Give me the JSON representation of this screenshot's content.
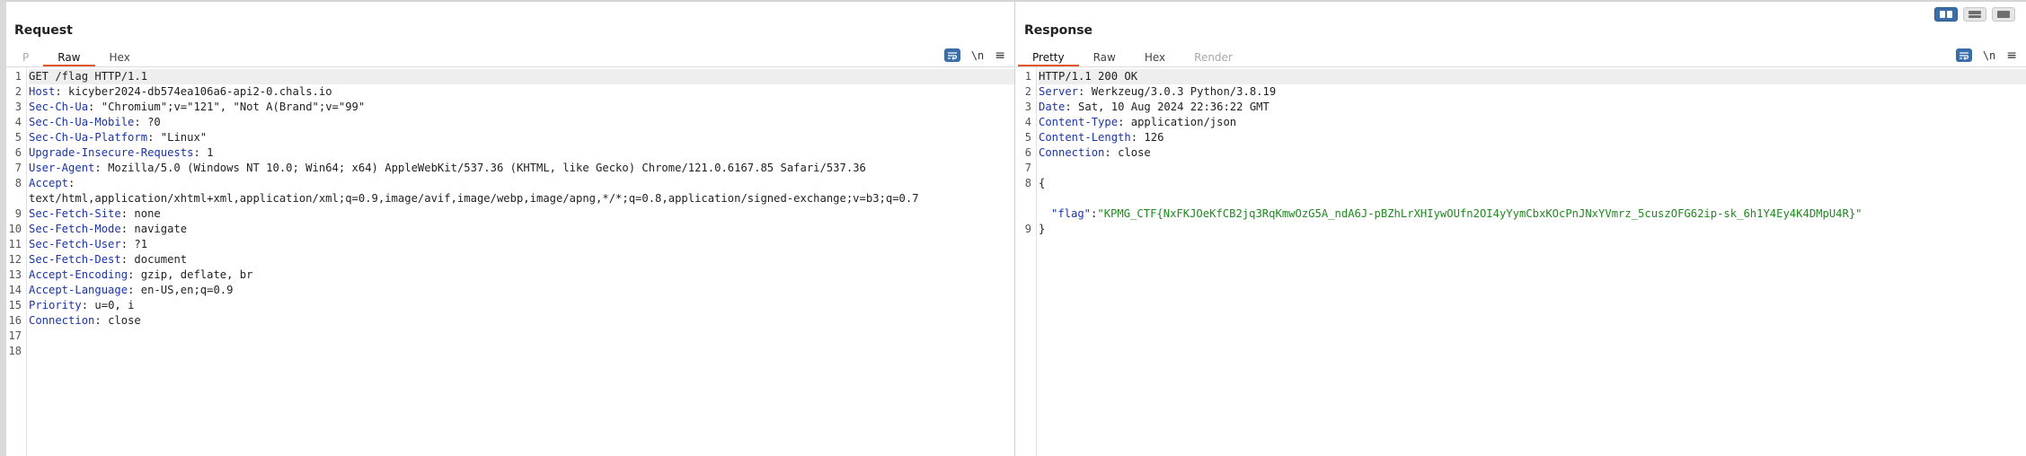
{
  "layout_buttons": [
    {
      "name": "side-by-side",
      "active": true
    },
    {
      "name": "top-bottom",
      "active": false
    },
    {
      "name": "tabs-only",
      "active": false
    }
  ],
  "request": {
    "title": "Request",
    "tabs": [
      "P",
      "Raw",
      "Hex"
    ],
    "tools": {
      "newline": "\\n",
      "menu": "≡"
    },
    "first_line": "GET /flag HTTP/1.1",
    "headers": [
      {
        "name": "Host",
        "sep": ": ",
        "value": "kicyber2024-db574ea106a6-api2-0.chals.io"
      },
      {
        "name": "Sec-Ch-Ua",
        "sep": ": ",
        "value": "\"Chromium\";v=\"121\", \"Not A(Brand\";v=\"99\""
      },
      {
        "name": "Sec-Ch-Ua-Mobile",
        "sep": ": ",
        "value": "?0"
      },
      {
        "name": "Sec-Ch-Ua-Platform",
        "sep": ": ",
        "value": "\"Linux\""
      },
      {
        "name": "Upgrade-Insecure-Requests",
        "sep": ": ",
        "value": "1"
      },
      {
        "name": "User-Agent",
        "sep": ": ",
        "value": "Mozilla/5.0 (Windows NT 10.0; Win64; x64) AppleWebKit/537.36 (KHTML, like Gecko) Chrome/121.0.6167.85 Safari/537.36"
      },
      {
        "name": "Accept",
        "sep": ":",
        "value": "text/html,application/xhtml+xml,application/xml;q=0.9,image/avif,image/webp,image/apng,*/*;q=0.8,application/signed-exchange;v=b3;q=0.7"
      },
      {
        "name": "Sec-Fetch-Site",
        "sep": ": ",
        "value": "none"
      },
      {
        "name": "Sec-Fetch-Mode",
        "sep": ": ",
        "value": "navigate"
      },
      {
        "name": "Sec-Fetch-User",
        "sep": ": ",
        "value": "?1"
      },
      {
        "name": "Sec-Fetch-Dest",
        "sep": ": ",
        "value": "document"
      },
      {
        "name": "Accept-Encoding",
        "sep": ": ",
        "value": "gzip, deflate, br"
      },
      {
        "name": "Accept-Language",
        "sep": ": ",
        "value": "en-US,en;q=0.9"
      },
      {
        "name": "Priority",
        "sep": ": ",
        "value": "u=0, i"
      },
      {
        "name": "Connection",
        "sep": ": ",
        "value": "close"
      }
    ],
    "line_numbers": [
      "1",
      "2",
      "3",
      "4",
      "5",
      "6",
      "7",
      "8",
      "9",
      "10",
      "11",
      "12",
      "13",
      "14",
      "15",
      "16",
      "17",
      "18"
    ]
  },
  "response": {
    "title": "Response",
    "tabs": [
      "Pretty",
      "Raw",
      "Hex",
      "Render"
    ],
    "tools": {
      "newline": "\\n",
      "menu": "≡"
    },
    "status_line": "HTTP/1.1 200 OK",
    "headers": [
      {
        "name": "Server",
        "sep": ": ",
        "value": "Werkzeug/3.0.3 Python/3.8.19"
      },
      {
        "name": "Date",
        "sep": ": ",
        "value": "Sat, 10 Aug 2024 22:36:22 GMT"
      },
      {
        "name": "Content-Type",
        "sep": ": ",
        "value": "application/json"
      },
      {
        "name": "Content-Length",
        "sep": ": ",
        "value": "126"
      },
      {
        "name": "Connection",
        "sep": ": ",
        "value": "close"
      }
    ],
    "body": {
      "open_brace": "{",
      "key": "\"flag\"",
      "colon": ":",
      "value": "\"KPMG_CTF{NxFKJOeKfCB2jq3RqKmwOzG5A_ndA6J-pBZhLrXHIywOUfn2OI4yYymCbxKOcPnJNxYVmrz_5cuszOFG62ip-sk_6h1Y4Ey4K4DMpU4R}\"",
      "close_brace": "}"
    },
    "line_numbers": [
      "1",
      "2",
      "3",
      "4",
      "5",
      "6",
      "7",
      "8",
      "",
      "",
      "9"
    ]
  }
}
